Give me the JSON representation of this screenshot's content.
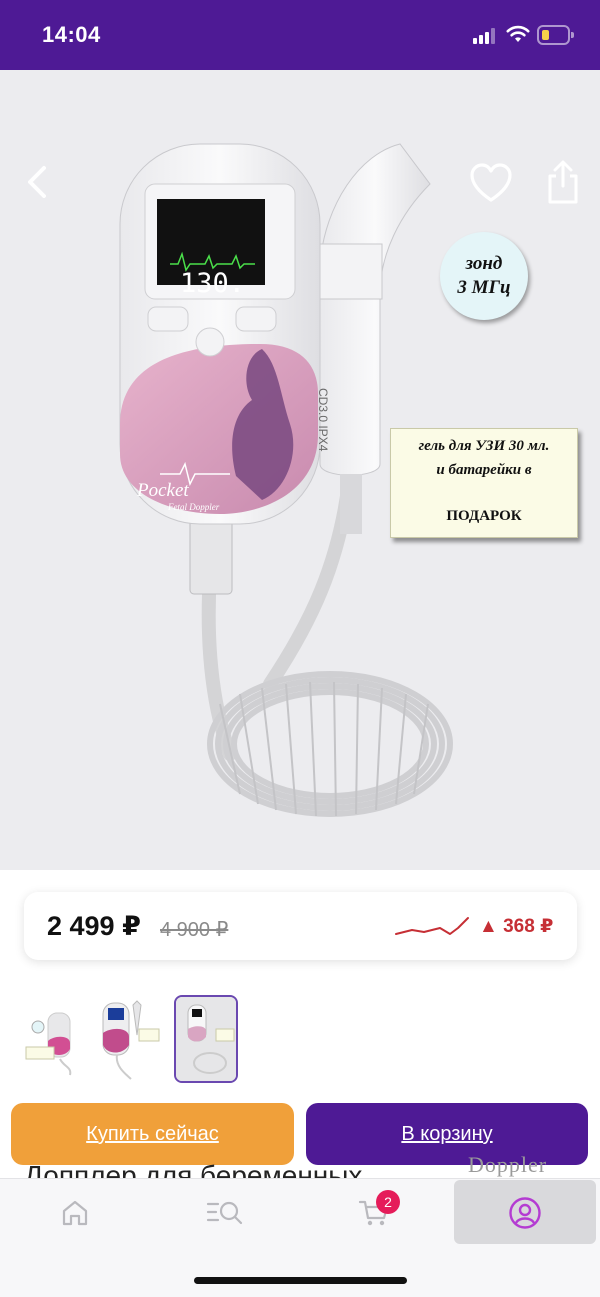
{
  "status_bar": {
    "time": "14:04",
    "icons": [
      "cellular-signal-icon",
      "wifi-icon",
      "battery-low-icon"
    ],
    "background": "#4e1a95"
  },
  "gallery": {
    "actions": [
      "back-icon",
      "heart-icon",
      "share-icon"
    ],
    "overlay_probe": [
      "зонд",
      "3 МГц"
    ],
    "overlay_gift": [
      "гель для УЗИ 30 мл.",
      "и батарейки в",
      "ПОДАРОК"
    ],
    "device_screen_value": "130.",
    "device_brand": "Pocket",
    "device_subbrand": "Fetal Doppler",
    "probe_label": "CD3.0  IPX4"
  },
  "price": {
    "current": "2 499 ₽",
    "old": "4 900 ₽",
    "delta": "▲ 368 ₽",
    "trend_icon": "price-trend-line-icon",
    "delta_color": "#c62f35"
  },
  "thumbnails": {
    "count": 3,
    "selected_index": 2
  },
  "actions": {
    "buy_now": "Купить сейчас",
    "add_to_cart": "В корзину",
    "buy_now_color": "#f0a03a",
    "cart_color": "#4e1a95"
  },
  "product": {
    "title": "Допплер для беременных",
    "brand_tag": "Doppler"
  },
  "bottom_nav": {
    "items": [
      "home-icon",
      "catalog-search-icon",
      "cart-icon",
      "profile-icon"
    ],
    "cart_count": "2",
    "active_color": "#b43cd2"
  }
}
